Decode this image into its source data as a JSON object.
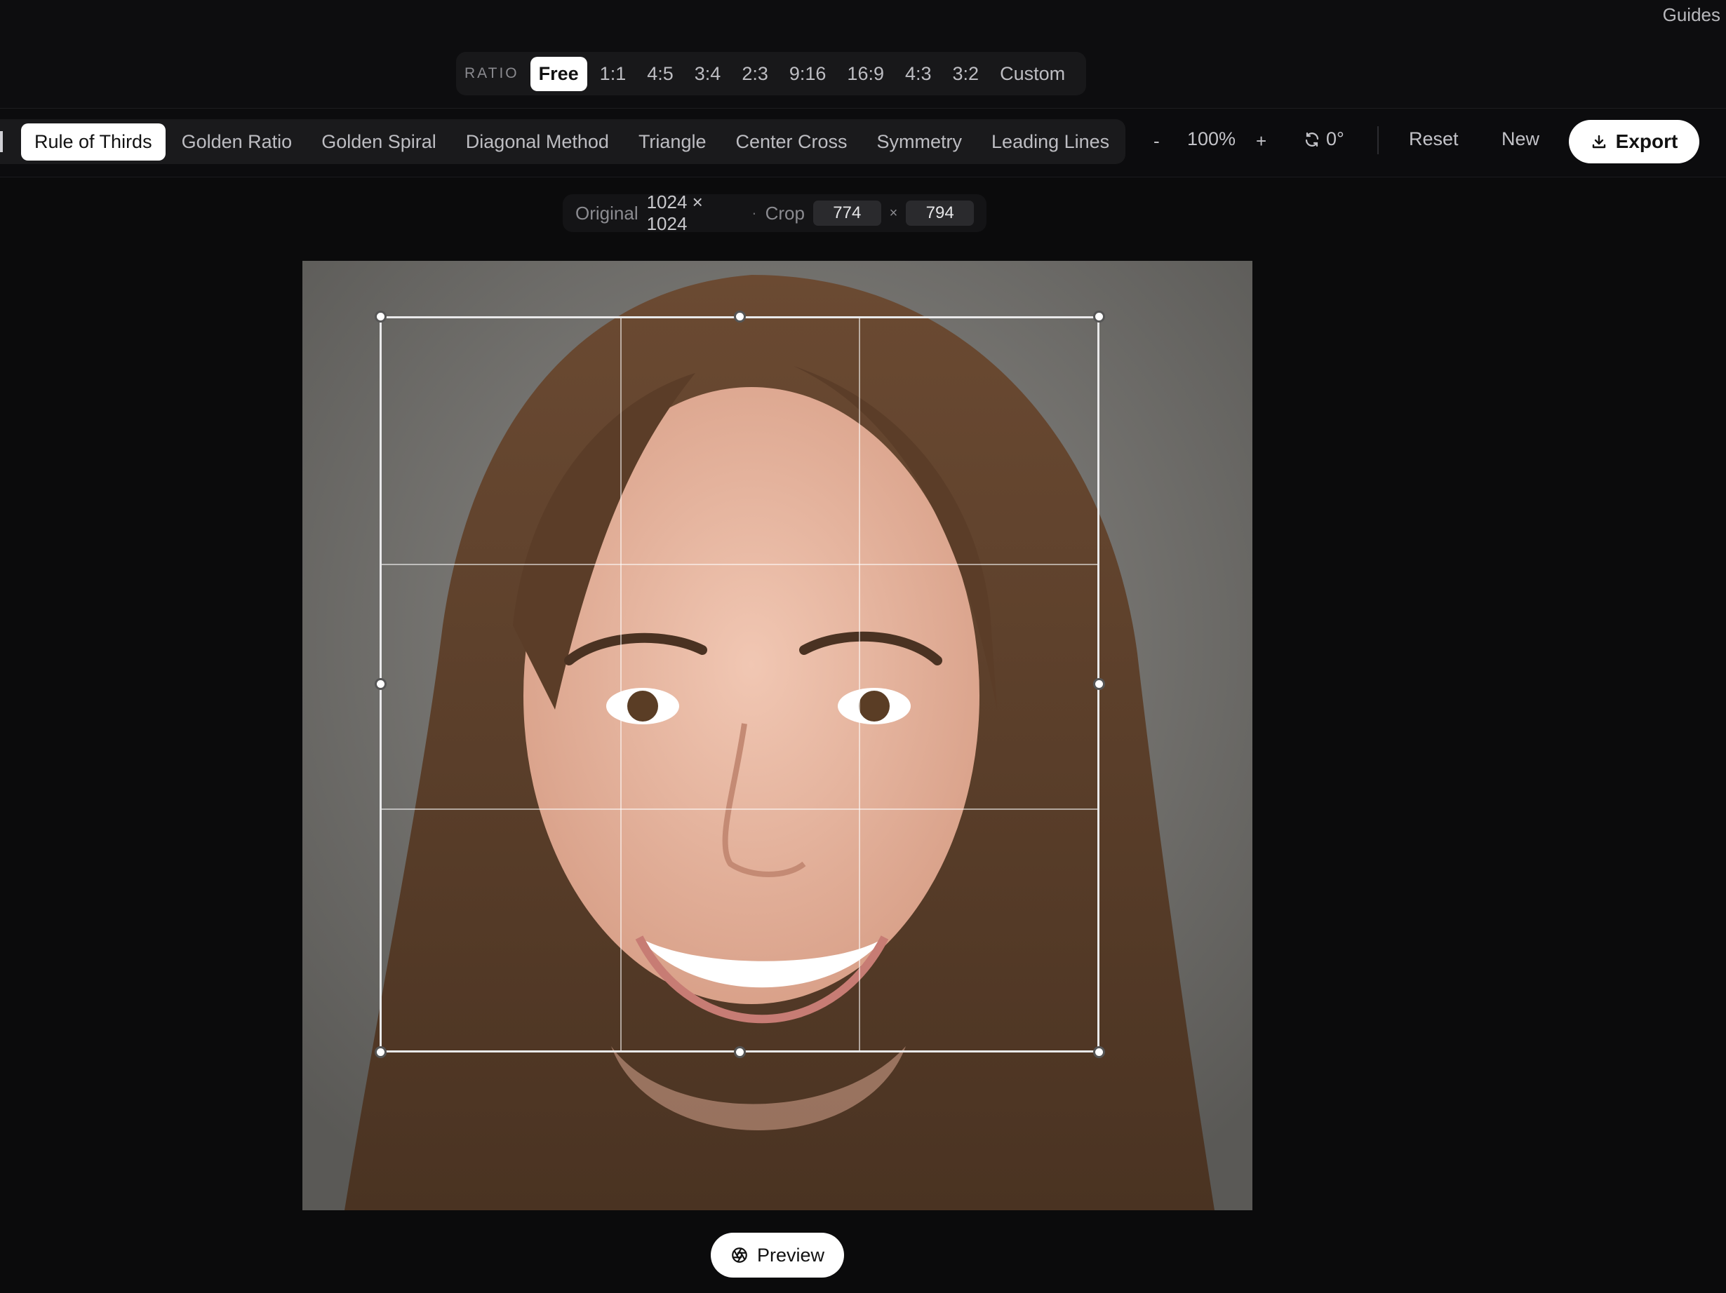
{
  "guides_label": "Guides",
  "ratio": {
    "label": "RATIO",
    "options": [
      "Free",
      "1:1",
      "4:5",
      "3:4",
      "2:3",
      "9:16",
      "16:9",
      "4:3",
      "3:2",
      "Custom"
    ],
    "selected": "Free"
  },
  "guides": {
    "options": [
      "Rule of Thirds",
      "Golden Ratio",
      "Golden Spiral",
      "Diagonal Method",
      "Triangle",
      "Center Cross",
      "Symmetry",
      "Leading Lines"
    ],
    "selected": "Rule of Thirds"
  },
  "zoom": {
    "minus_label": "-",
    "value": "100%",
    "plus_label": "+"
  },
  "rotation": {
    "icon": "rotate-icon",
    "value": "0°"
  },
  "actions": {
    "reset": "Reset",
    "new": "New",
    "export": "Export",
    "export_icon": "download-icon"
  },
  "info": {
    "original_label": "Original",
    "original_value": "1024 × 1024",
    "separator": "·",
    "crop_label": "Crop",
    "crop_width": "774",
    "times": "×",
    "crop_height": "794"
  },
  "image": {
    "subject": "portrait-photo",
    "overlay_guide": "rule-of-thirds"
  },
  "preview": {
    "label": "Preview",
    "icon": "aperture-icon"
  },
  "colors": {
    "background": "#0b0b0c",
    "accent": "#ffffff",
    "panel": "#1a1a1c"
  }
}
